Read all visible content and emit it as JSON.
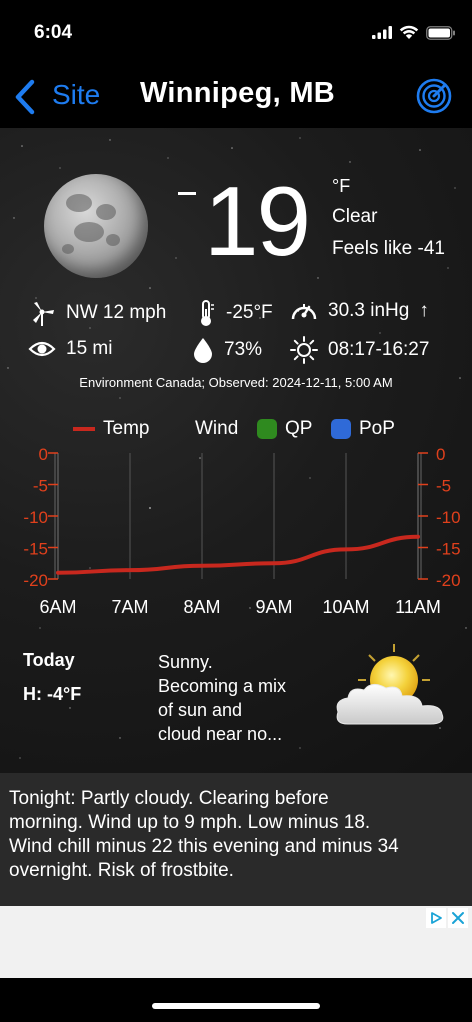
{
  "status": {
    "time": "6:04"
  },
  "nav": {
    "back_label": "Site",
    "title": "Winnipeg, MB",
    "radar_icon": "radar-icon"
  },
  "current": {
    "temperature": "19",
    "sign": "-",
    "unit": "°F",
    "condition": "Clear",
    "feels_like": "Feels like -41",
    "wind": "NW 12 mph",
    "dewpoint": "-25°F",
    "pressure": "30.3 inHg",
    "pressure_trend": "↑",
    "visibility": "15 mi",
    "humidity": "73%",
    "sun": "08:17-16:27",
    "observed": "Environment Canada; Observed: 2024-12-11, 5:00 AM"
  },
  "legend": {
    "temp": "Temp",
    "wind": "Wind",
    "qp": "QP",
    "pop": "PoP"
  },
  "colors": {
    "temp_line": "#c8281e",
    "axis_label": "#e0401c",
    "qp": "#2f8a1f",
    "pop": "#2f6ad8",
    "accent": "#1e7cf0"
  },
  "chart_data": {
    "type": "line",
    "x": [
      "6AM",
      "7AM",
      "8AM",
      "9AM",
      "10AM",
      "11AM"
    ],
    "y_ticks_left": [
      "0",
      "-5",
      "-10",
      "-15",
      "-20"
    ],
    "y_ticks_right": [
      "0",
      "-5",
      "-10",
      "-15",
      "-20"
    ],
    "ylim": [
      -20,
      0
    ],
    "series": [
      {
        "name": "Temp",
        "values": [
          -19,
          -18.6,
          -17.9,
          -17.5,
          -15.3,
          -13.3
        ]
      }
    ]
  },
  "today": {
    "label": "Today",
    "high": "H: -4°F",
    "forecast_lines": [
      "Sunny.",
      "Becoming a mix",
      "of sun and",
      "cloud near no..."
    ]
  },
  "tonight": {
    "lines": [
      "Tonight:  Partly cloudy. Clearing before",
      "morning. Wind up to 9 mph. Low minus 18.",
      "Wind chill minus 22 this evening and minus 34",
      "overnight. Risk of frostbite."
    ]
  }
}
